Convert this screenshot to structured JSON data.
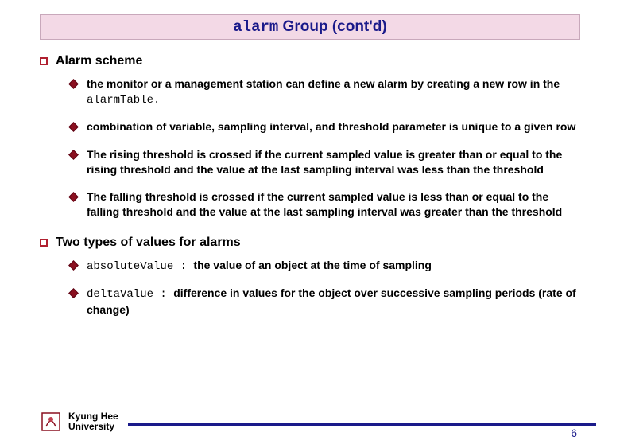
{
  "title": {
    "mono": "alarm",
    "rest": " Group (cont'd)"
  },
  "sections": [
    {
      "heading": "Alarm scheme",
      "items": [
        {
          "pre": " the monitor or a management station can define a new alarm by creating a new row in the ",
          "mono": "alarmTable.",
          "post": ""
        },
        {
          "pre": " combination of variable, sampling interval, and threshold parameter is unique to a given row",
          "mono": "",
          "post": ""
        },
        {
          "pre": " The rising threshold is crossed if the current sampled value is greater than or equal to the rising threshold and the value at the last sampling interval was less than the threshold",
          "mono": "",
          "post": ""
        },
        {
          "pre": " The falling threshold is crossed if the current sampled value is less than or equal to the falling threshold and the value at the last sampling interval was greater than the threshold",
          "mono": "",
          "post": ""
        }
      ]
    },
    {
      "heading": "Two types of values for alarms",
      "items": [
        {
          "pre": "",
          "mono": "absoluteValue : ",
          "post": "the value of an object at the time of sampling"
        },
        {
          "pre": "",
          "mono": "deltaValue : ",
          "post": "difference in values for the object over successive sampling periods (rate of change)"
        }
      ]
    }
  ],
  "footer": {
    "line1": "Kyung Hee",
    "line2": "University"
  },
  "page": "6"
}
